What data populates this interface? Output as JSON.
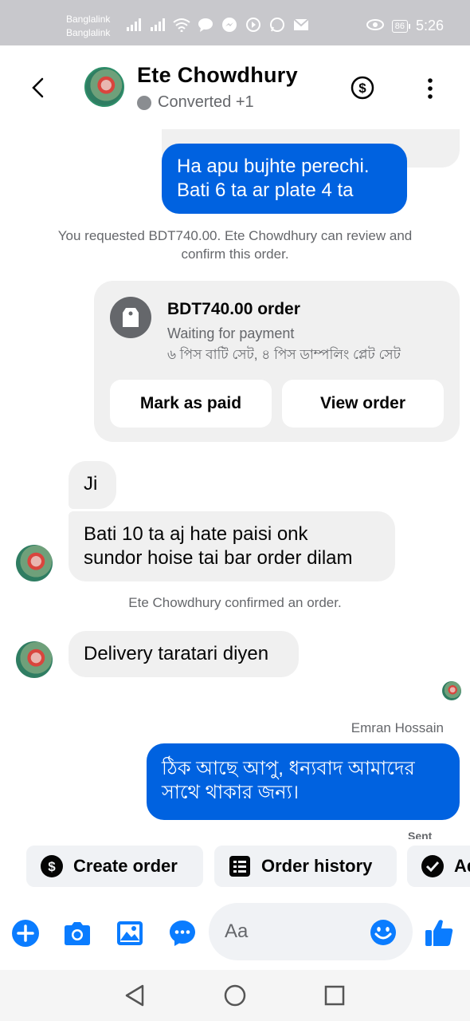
{
  "status_bar": {
    "carrier1": "Banglalink",
    "carrier2": "Banglalink",
    "battery": "86",
    "time": "5:26"
  },
  "header": {
    "name": "Ete Chowdhury",
    "status": "Converted +1"
  },
  "messages": {
    "out1_line1": "Ha apu bujhte perechi.",
    "out1_line2": "Bati  6 ta ar plate  4 ta",
    "system1": "You requested BDT740.00. Ete Chowdhury can review and confirm this order.",
    "in1": "Ji",
    "in2_line1": "Bati 10 ta aj hate paisi onk",
    "in2_line2": "sundor hoise tai bar order dilam",
    "system2": "Ete Chowdhury confirmed an order.",
    "in3": "Delivery taratari diyen",
    "sender": "Emran Hossain",
    "out2_line1": "ঠিক আছে আপু, ধন্যবাদ আমাদের",
    "out2_line2": "সাথে থাকার জন্য।",
    "sent": "Sent"
  },
  "order_card": {
    "title": "BDT740.00 order",
    "status": "Waiting for payment",
    "items": "৬ পিস বাটি সেট,  ৪ পিস ডাম্পলিং প্লেট সেট",
    "mark_paid": "Mark as paid",
    "view_order": "View order"
  },
  "quick_actions": {
    "create_order": "Create order",
    "order_history": "Order history",
    "third": "Ad"
  },
  "composer": {
    "placeholder": "Aa"
  },
  "colors": {
    "accent": "#0062e0",
    "messenger_blue": "#0a7cff",
    "bubble_gray": "#f0f0f0"
  }
}
